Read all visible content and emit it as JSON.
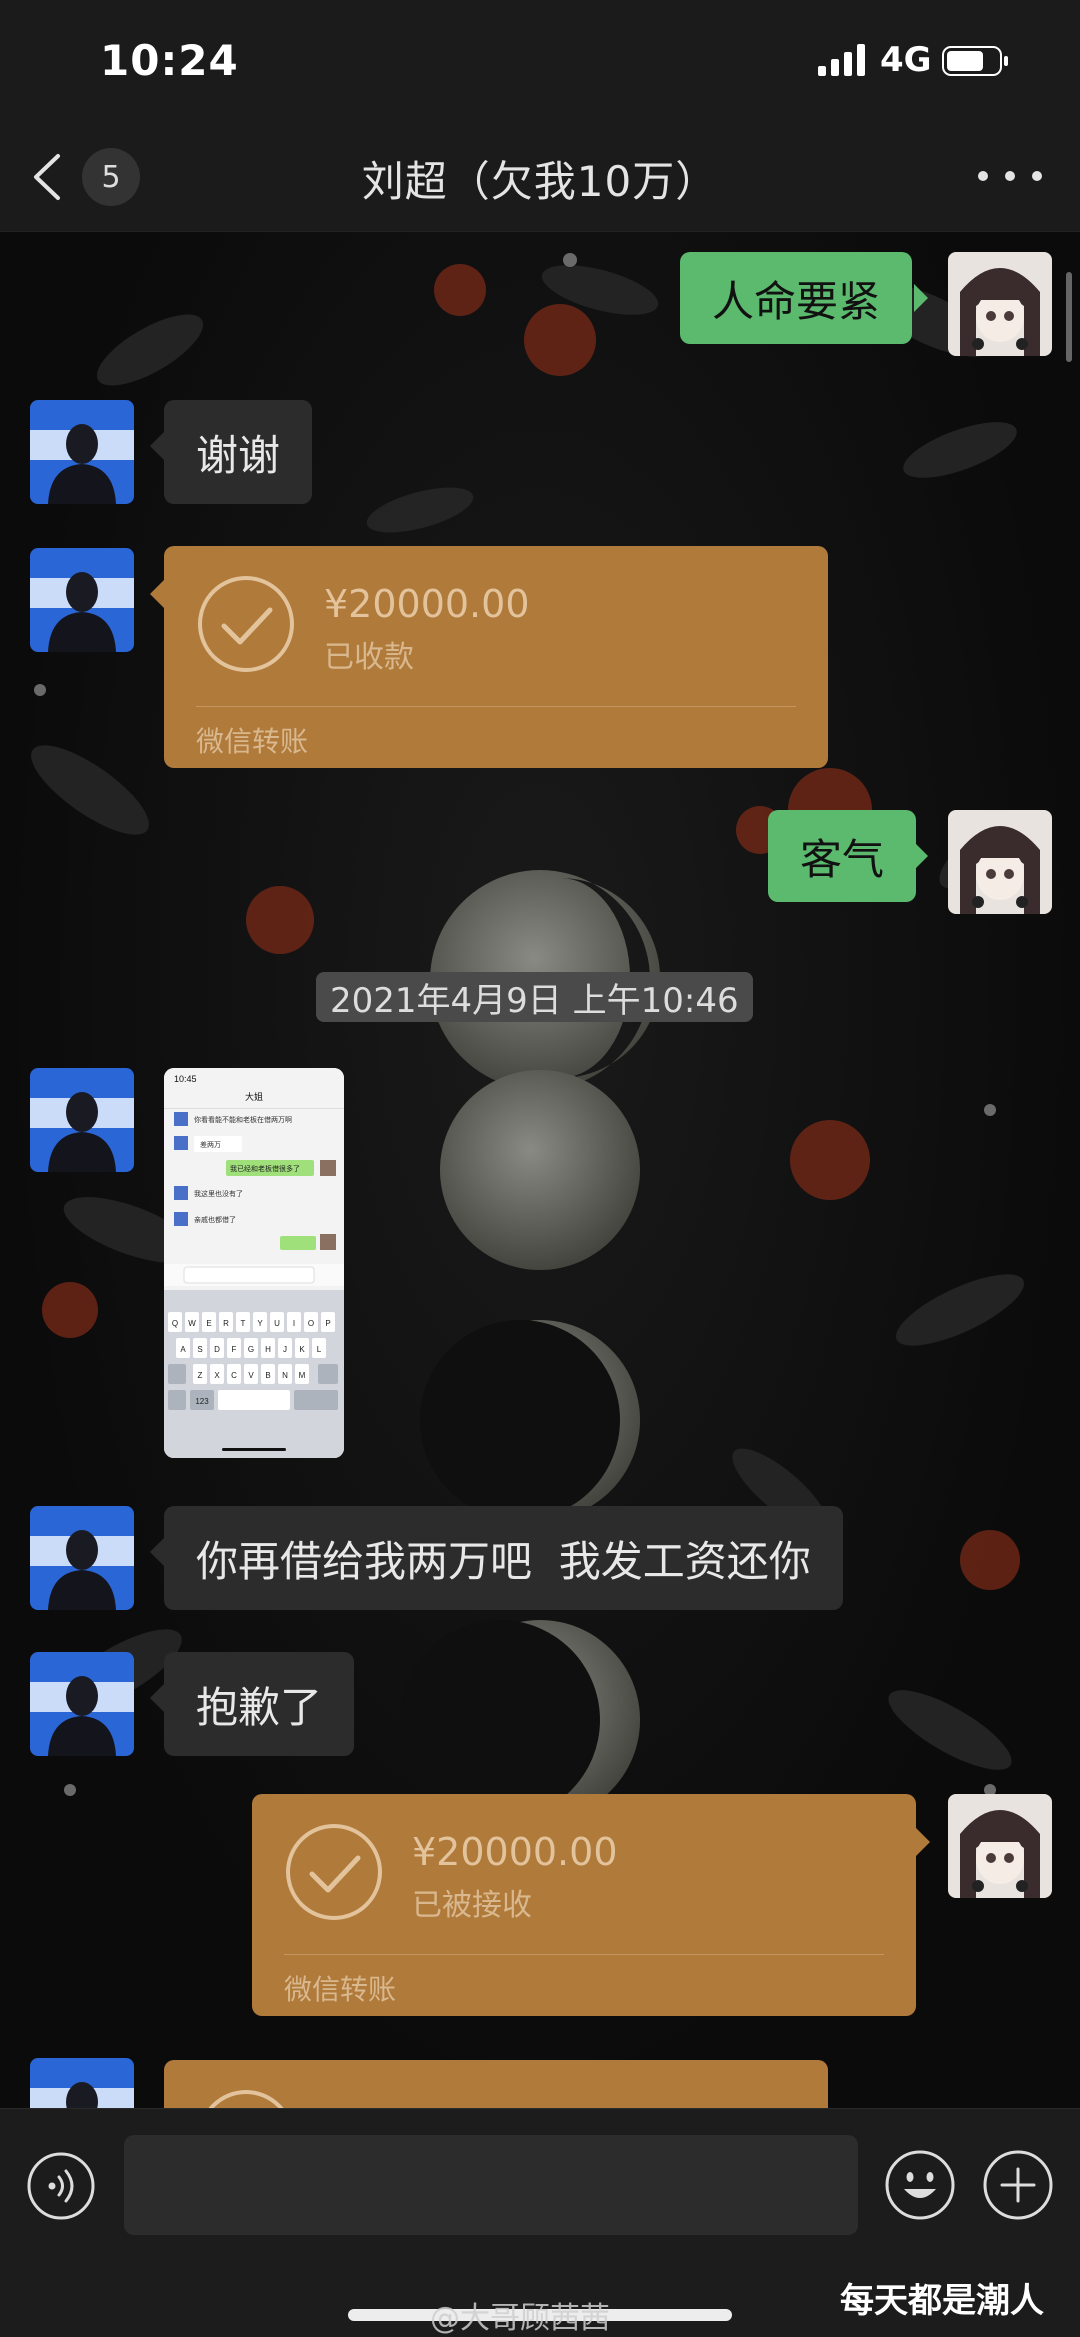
{
  "status_bar": {
    "time": "10:24",
    "network": "4G"
  },
  "nav": {
    "unread_count": "5",
    "title": "刘超（欠我10万）"
  },
  "messages": [
    {
      "side": "right",
      "type": "text",
      "text": "人命要紧"
    },
    {
      "side": "left",
      "type": "text",
      "text": "谢谢"
    },
    {
      "side": "left",
      "type": "transfer",
      "amount": "¥20000.00",
      "state": "已收款",
      "source": "微信转账"
    },
    {
      "side": "right",
      "type": "text",
      "text": "客气"
    },
    {
      "type": "timestamp",
      "text": "2021年4月9日 上午10:46"
    },
    {
      "side": "left",
      "type": "image"
    },
    {
      "side": "left",
      "type": "text",
      "text": "你再借给我两万吧  我发工资还你"
    },
    {
      "side": "left",
      "type": "text",
      "text": "抱歉了"
    },
    {
      "side": "right",
      "type": "transfer",
      "amount": "¥20000.00",
      "state": "已被接收",
      "source": "微信转账"
    },
    {
      "side": "left",
      "type": "transfer_partial"
    }
  ],
  "screenshot_thumb": {
    "time": "10:45",
    "title": "大姐",
    "lines": [
      "你看看能不能和老板在借两万啊",
      "差两万",
      "我已经和老板借很多了",
      "我这里也没有了",
      "亲戚也都借了"
    ],
    "keyboard_rows": [
      "QWERTYUIOP",
      "ASDFGHJKL",
      "ZXCVBNM"
    ],
    "key_123": "123"
  },
  "watermarks": {
    "weibo": "@大哥顾茜茜",
    "right": "每天都是潮人"
  },
  "colors": {
    "green_bubble": "#5cba6e",
    "dark_bubble": "#2c2c2c",
    "transfer": "#b07a3a"
  }
}
